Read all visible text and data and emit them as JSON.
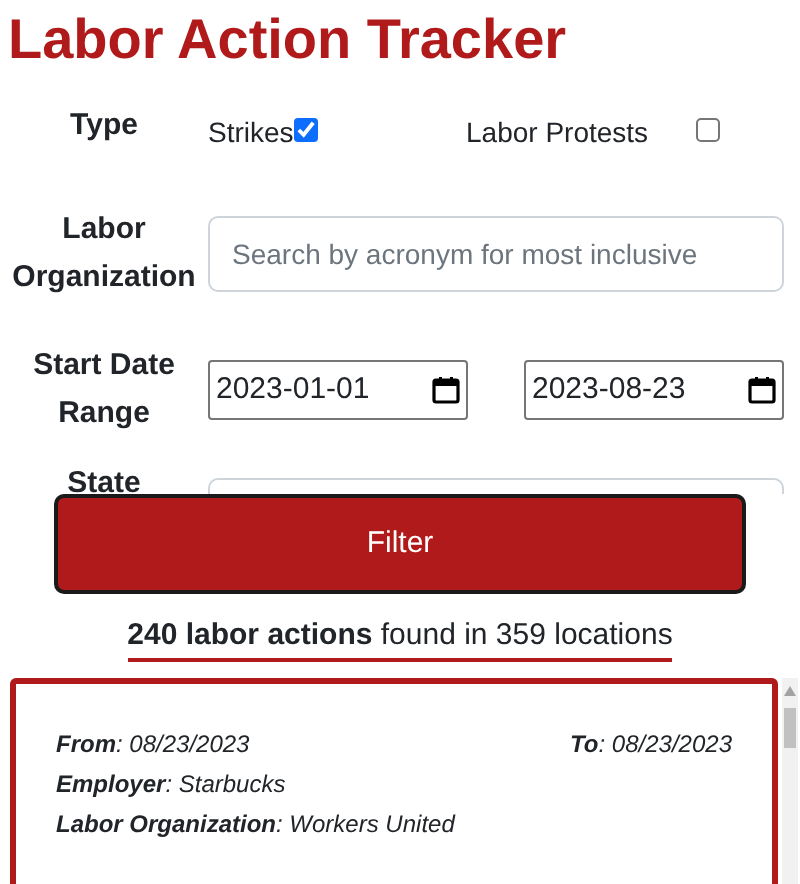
{
  "title": "Labor Action Tracker",
  "type_filter": {
    "label": "Type",
    "options": [
      {
        "label": "Strikes",
        "checked": true
      },
      {
        "label": "Labor Protests",
        "checked": false
      }
    ]
  },
  "organization_filter": {
    "label": "Labor Organization",
    "placeholder": "Search by acronym for most inclusive"
  },
  "date_filter": {
    "label": "Start Date Range",
    "start": "2023-01-01",
    "end": "2023-08-23"
  },
  "state_filter": {
    "label": "State"
  },
  "filter_button": "Filter",
  "summary": "**240 labor actions** found in 359 locations",
  "actions": [
    {
      "from": "**From**: 08/23/2023",
      "to": "**To**: 08/23/2023",
      "employer": "**Employer**: Starbucks",
      "organization": "**Labor Organization**: Workers United"
    }
  ]
}
